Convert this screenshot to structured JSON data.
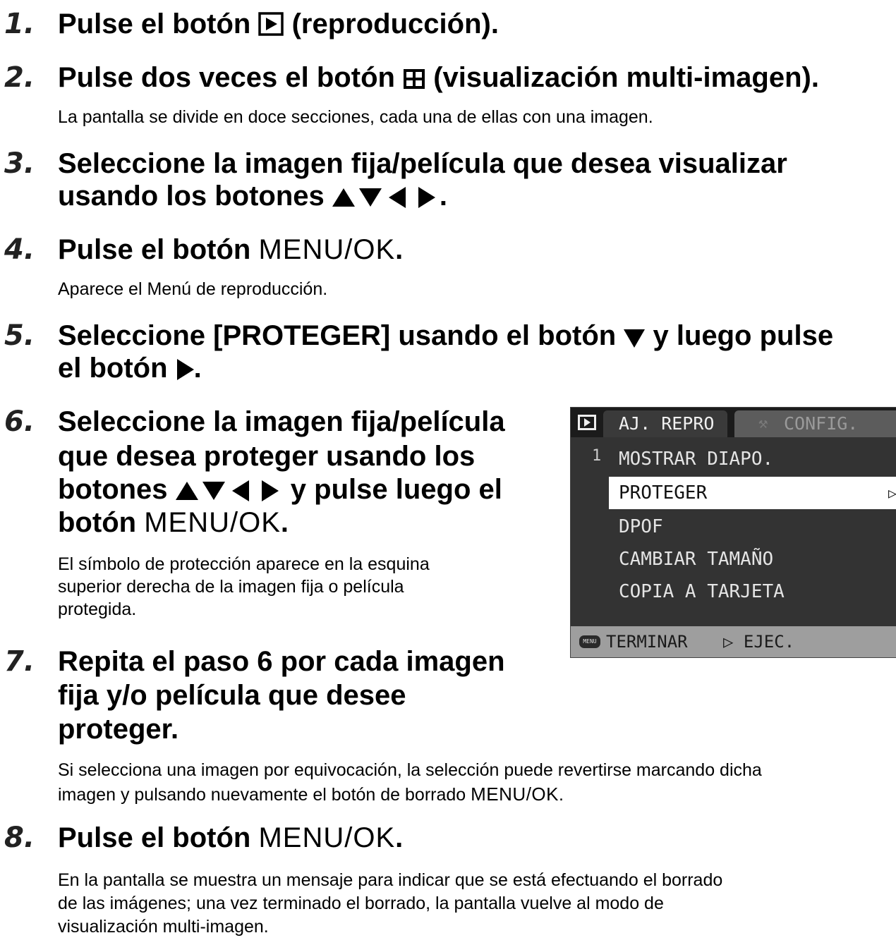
{
  "steps": [
    {
      "num": "1.",
      "text_a": "Pulse el botón",
      "icon": "play-icon",
      "text_b": "(reproducción)."
    },
    {
      "num": "2.",
      "text_a": "Pulse dos veces el botón",
      "icon": "multi-image-icon",
      "text_b": "(visualización multi-imagen).",
      "desc": "La pantalla se divide en doce secciones, cada una de ellas con una imagen."
    },
    {
      "num": "3.",
      "line1": "Seleccione la imagen fija/película que desea visualizar",
      "line2_a": "usando los botones",
      "icon": "arrow-buttons-icon",
      "line2_b": "."
    },
    {
      "num": "4.",
      "text_a": "Pulse el botón",
      "button": "MENU/OK",
      "text_b": ".",
      "desc": "Aparece el Menú de reproducción."
    },
    {
      "num": "5.",
      "line1_a": "Seleccione [PROTEGER] usando el botón",
      "icon1": "down-arrow-icon",
      "line1_b": "y luego pulse",
      "line2_a": "el botón",
      "icon2": "right-arrow-icon",
      "line2_b": "."
    },
    {
      "num": "6.",
      "line1": "Seleccione la imagen fija/película",
      "line2": "que desea proteger usando los",
      "line3_a": "botones",
      "icon": "arrow-buttons-icon",
      "line3_b": "y pulse luego el",
      "line4_a": "botón",
      "button": "MENU/OK",
      "line4_b": ".",
      "desc1": "El símbolo de protección aparece en la esquina",
      "desc2": "superior derecha de la imagen fija o película",
      "desc3": "protegida."
    },
    {
      "num": "7.",
      "line1": "Repita el paso 6 por cada imagen",
      "line2": "fija y/o película que desee",
      "line3": "proteger.",
      "desc1": "Si selecciona una imagen por equivocación, la selección puede revertirse marcando dicha",
      "desc2_a": "imagen y pulsando nuevamente el botón de borrado",
      "desc2_button": "MENU/OK",
      "desc2_b": "."
    },
    {
      "num": "8.",
      "text_a": "Pulse el botón",
      "button": "MENU/OK",
      "text_b": ".",
      "desc1": "En la pantalla se muestra un mensaje para indicar que se está efectuando el borrado",
      "desc2": "de las imágenes; una vez terminado el borrado, la pantalla vuelve al modo de",
      "desc3": "visualización multi-imagen."
    }
  ],
  "camera_screen": {
    "tab_active": "AJ. REPRO",
    "tab_inactive": "CONFIG.",
    "page": "1",
    "items": [
      "MOSTRAR DIAPO.",
      "PROTEGER",
      "DPOF",
      "CAMBIAR TAMAÑO",
      "COPIA A TARJETA"
    ],
    "selected_index": 1,
    "selected_arrow": "▷",
    "menu_icon_label": "MENU",
    "footer_exit": "TERMINAR",
    "footer_exec": "▷ EJEC."
  }
}
